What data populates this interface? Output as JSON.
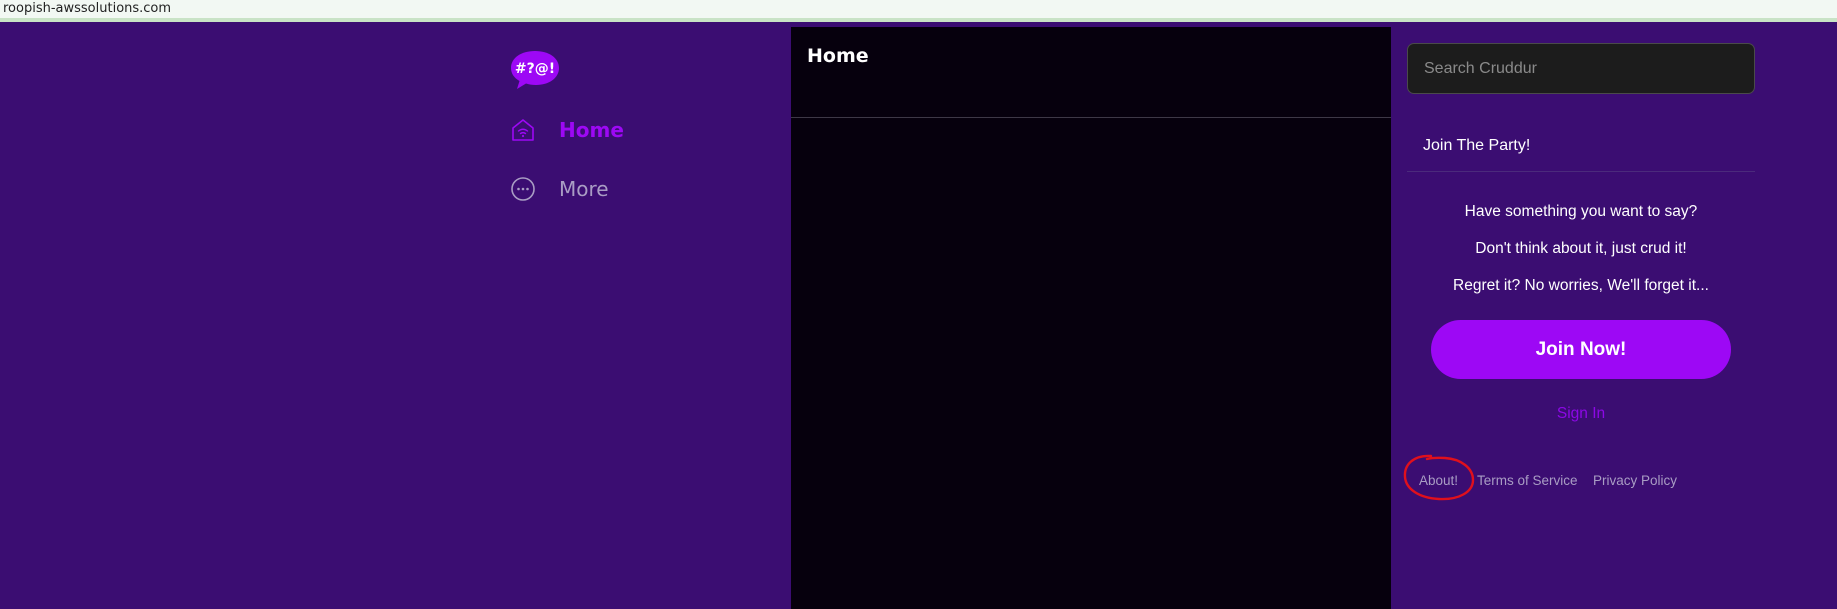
{
  "browser": {
    "url": "roopish-awssolutions.com"
  },
  "logo": {
    "text": "#?@!",
    "color": "#9d08f5"
  },
  "nav": {
    "items": [
      {
        "label": "Home",
        "icon": "home-icon",
        "active": true
      },
      {
        "label": "More",
        "icon": "more-dots-icon",
        "active": false
      }
    ]
  },
  "main": {
    "title": "Home"
  },
  "sidebar": {
    "search_placeholder": "Search Cruddur",
    "join_title": "Join The Party!",
    "pitch": [
      "Have something you want to say?",
      "Don't think about it, just crud it!",
      "Regret it? No worries, We'll forget it..."
    ],
    "join_button": "Join Now!",
    "sign_in": "Sign In",
    "footer_links": [
      "About!",
      "Terms of Service",
      "Privacy Policy"
    ]
  },
  "colors": {
    "background": "#3b0d72",
    "center": "#06000d",
    "accent": "#9d08f5",
    "muted": "#a99dc4",
    "annotation": "#e0101c"
  }
}
